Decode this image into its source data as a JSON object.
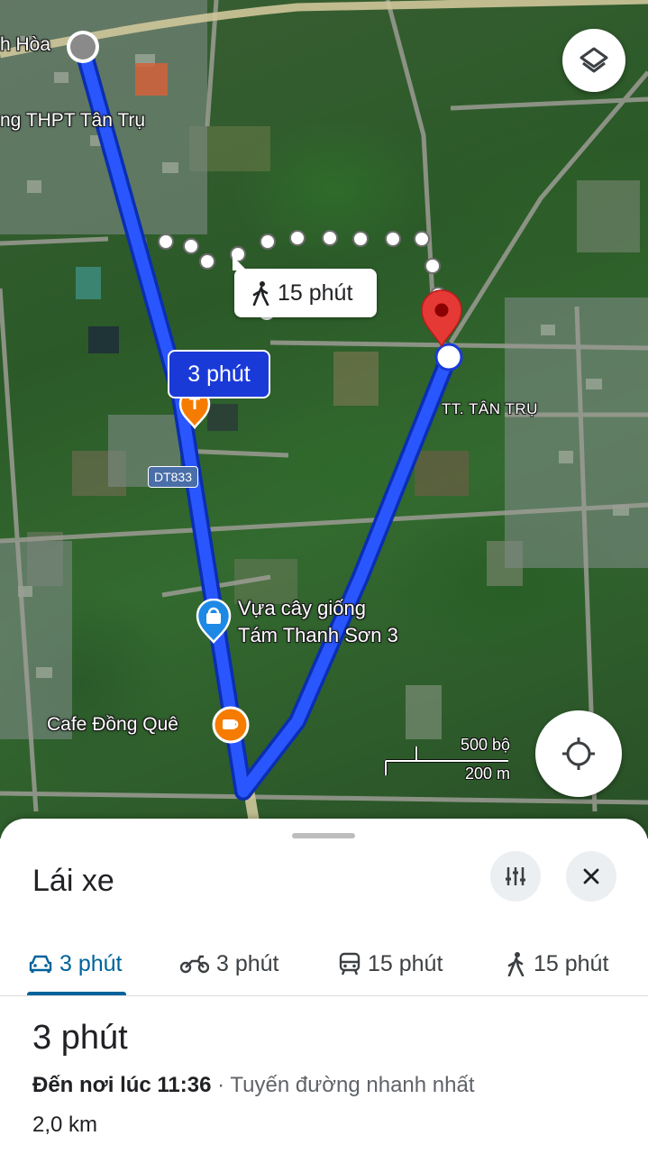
{
  "map": {
    "labels": {
      "hoa": "h Hòa",
      "school": "ng THPT Tân Trụ",
      "town": "TT. TÂN TRỤ",
      "nursery_line1": "Vựa cây giống",
      "nursery_line2": "Tám Thanh Sơn 3",
      "cafe": "Cafe Đồng Quê",
      "road_shield": "DT833"
    },
    "callouts": {
      "walking": "15 phút",
      "driving": "3 phút"
    },
    "scale": {
      "top": "500 bộ",
      "bottom": "200 m"
    },
    "icons": {
      "layers": "layers-icon",
      "locate": "my-location-icon",
      "destination": "red-pin-icon",
      "origin": "grey-origin-dot-icon"
    },
    "colors": {
      "route": "#1a3ad8",
      "destination_pin": "#e53935",
      "walk_dots": "#ffffff",
      "poi_orange": "#f57c00",
      "poi_blue": "#1e88e5"
    }
  },
  "sheet": {
    "title": "Lái xe",
    "modes": [
      {
        "icon": "car-icon",
        "label": "3 phút",
        "active": true
      },
      {
        "icon": "motorbike-icon",
        "label": "3 phút",
        "active": false
      },
      {
        "icon": "transit-icon",
        "label": "15 phút",
        "active": false
      },
      {
        "icon": "walking-icon",
        "label": "15 phút",
        "active": false
      }
    ],
    "summary": {
      "time": "3 phút",
      "arrival": "Đến nơi lúc 11:36",
      "separator": " · ",
      "route_note": "Tuyến đường nhanh nhất",
      "distance": "2,0 km"
    }
  }
}
